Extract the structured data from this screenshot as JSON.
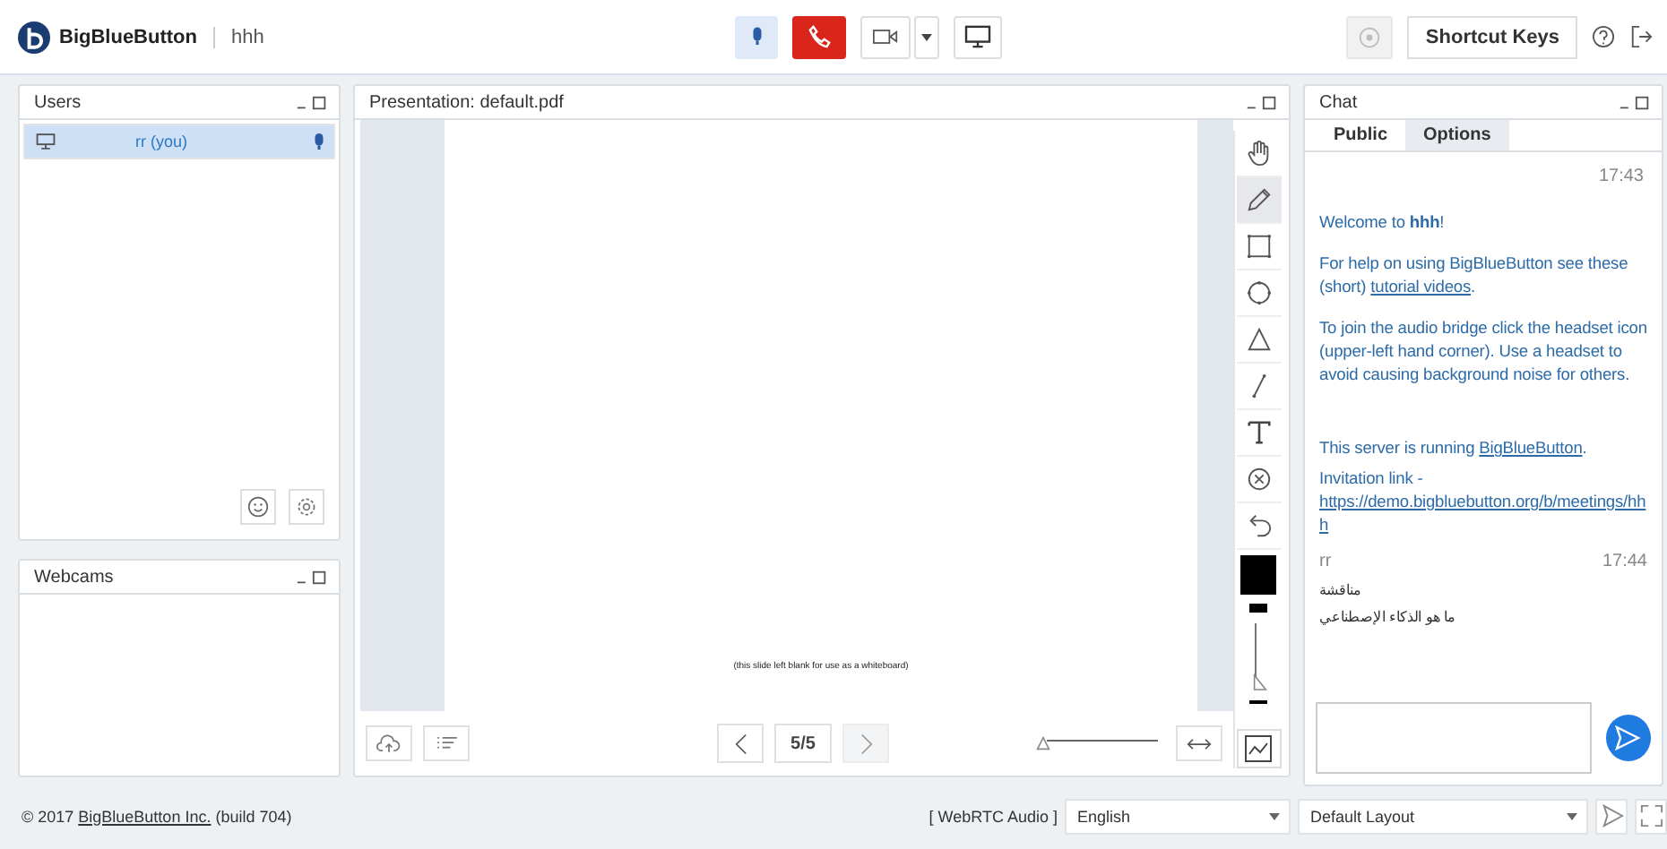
{
  "header": {
    "logo": "BigBlueButton",
    "meeting": "hhh",
    "shortcut_button": "Shortcut Keys"
  },
  "users_panel": {
    "title": "Users",
    "users": [
      {
        "name": "rr (you)",
        "selected": true
      }
    ]
  },
  "webcams_panel": {
    "title": "Webcams"
  },
  "presentation": {
    "title": "Presentation: default.pdf",
    "slide_text": "(this slide left blank for use as a whiteboard)",
    "page": "5/5",
    "prev_disabled": false,
    "next_disabled": true,
    "zoom": {
      "level": 0
    },
    "tools": [
      {
        "kind": "hand",
        "selected": false
      },
      {
        "kind": "pencil",
        "selected": true
      },
      {
        "kind": "rectangle",
        "selected": false
      },
      {
        "kind": "ellipse",
        "selected": false
      },
      {
        "kind": "triangle",
        "selected": false
      },
      {
        "kind": "line",
        "selected": false
      },
      {
        "kind": "text",
        "selected": false
      },
      {
        "kind": "clear",
        "selected": false
      },
      {
        "kind": "undo",
        "selected": false
      }
    ],
    "color": "#000000"
  },
  "chat": {
    "title": "Chat",
    "tabs": [
      {
        "label": "Public",
        "selected": true
      },
      {
        "label": "Options",
        "selected": false
      }
    ],
    "welcome": {
      "time": "17:43",
      "paragraphs": [
        [
          {
            "text": "Welcome to **hhh**!",
            "link": false
          }
        ],
        [
          {
            "text": "For help on using BigBlueButton see these (short) ",
            "link": false
          },
          {
            "text": "tutorial videos",
            "link": true
          },
          {
            "text": ".",
            "link": false
          }
        ],
        [
          {
            "text": "To join the audio bridge click the headset icon (upper-left hand corner).  Use a headset to avoid causing background noise for others.",
            "link": false
          }
        ],
        [
          {
            "text": "This server is running ",
            "link": false
          },
          {
            "text": "BigBlueButton",
            "link": true
          },
          {
            "text": ".",
            "link": false
          }
        ],
        [
          {
            "text": "Invitation link - ",
            "link": false
          },
          {
            "text": "https://demo.bigbluebutton.org/b/meetings/hhh",
            "link": true
          }
        ]
      ]
    },
    "messages": [
      {
        "sender": "rr",
        "time": "17:44",
        "lines": [
          "مناقشة",
          "ما هو الذكاء الإصطناعي"
        ]
      }
    ]
  },
  "footer": {
    "copyright_prefix": "© 2017 ",
    "copyright_link": "BigBlueButton Inc.",
    "copyright_suffix": " (build 704)",
    "audio": "[ WebRTC Audio ]",
    "language": "English",
    "layout": "Default Layout"
  }
}
